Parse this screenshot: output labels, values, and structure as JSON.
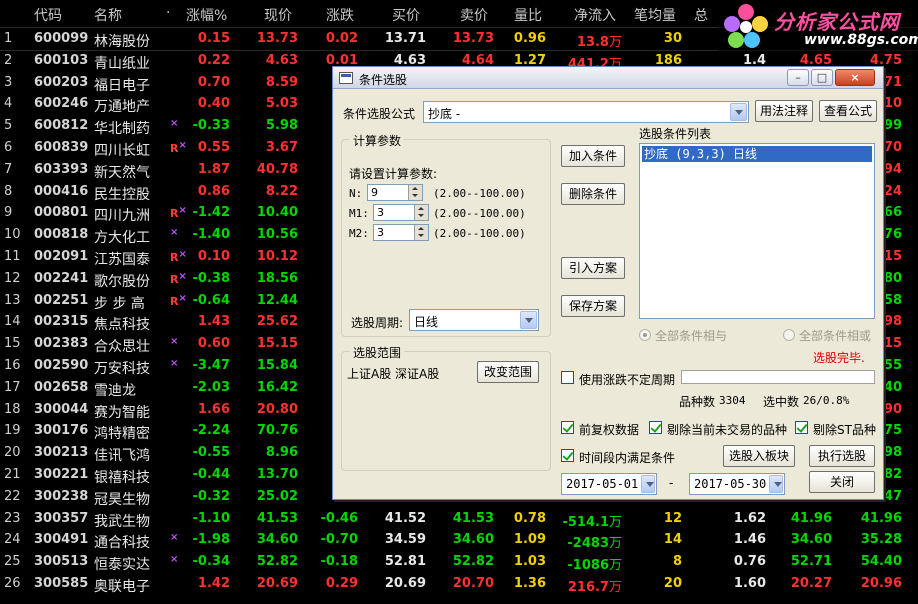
{
  "columns": [
    "代码",
    "名称",
    "·",
    "涨幅%",
    "现价",
    "涨跌",
    "买价",
    "卖价",
    "量比",
    "净流入",
    "笔均量",
    "总"
  ],
  "rows": [
    {
      "idx": "1",
      "code": "600099",
      "name": "林海股份",
      "flag": "",
      "chg": "0.15",
      "price": "13.73",
      "diff": "0.02",
      "bid": "13.71",
      "ask": "13.73",
      "ratio": "0.96",
      "flow": "13.8",
      "flow_unit": "万",
      "avg": "30",
      "tot": "",
      "h": "",
      "l": "",
      "up": true
    },
    {
      "idx": "2",
      "code": "600103",
      "name": "青山纸业",
      "flag": "",
      "chg": "0.22",
      "price": "4.63",
      "diff": "0.01",
      "bid": "4.63",
      "ask": "4.64",
      "ratio": "1.27",
      "flow": "441.2",
      "flow_unit": "万",
      "avg": "186",
      "tot": "1.4",
      "h": "4.65",
      "l": "4.75",
      "up": true
    },
    {
      "idx": "3",
      "code": "600203",
      "name": "福日电子",
      "flag": "",
      "chg": "0.70",
      "price": "8.59",
      "up": true,
      "h": "",
      "l": "",
      "l_tail": "71"
    },
    {
      "idx": "4",
      "code": "600246",
      "name": "万通地产",
      "flag": "",
      "chg": "0.40",
      "price": "5.03",
      "up": true,
      "l_tail": "10"
    },
    {
      "idx": "5",
      "code": "600812",
      "name": "华北制药",
      "flag": "x",
      "chg": "-0.33",
      "price": "5.98",
      "up": false,
      "l_tail": "99"
    },
    {
      "idx": "6",
      "code": "600839",
      "name": "四川长虹",
      "flag": "Rx",
      "chg": "0.55",
      "price": "3.67",
      "up": true,
      "l_tail": "70"
    },
    {
      "idx": "7",
      "code": "603393",
      "name": "新天然气",
      "flag": "",
      "chg": "1.87",
      "price": "40.78",
      "up": true,
      "l_tail": "94"
    },
    {
      "idx": "8",
      "code": "000416",
      "name": "民生控股",
      "flag": "",
      "chg": "0.86",
      "price": "8.22",
      "up": true,
      "l_tail": "24"
    },
    {
      "idx": "9",
      "code": "000801",
      "name": "四川九洲",
      "flag": "Rx",
      "chg": "-1.42",
      "price": "10.40",
      "up": false,
      "l_tail": "66"
    },
    {
      "idx": "10",
      "code": "000818",
      "name": "方大化工",
      "flag": "x",
      "chg": "-1.40",
      "price": "10.56",
      "up": false,
      "l_tail": "76"
    },
    {
      "idx": "11",
      "code": "002091",
      "name": "江苏国泰",
      "flag": "Rx",
      "chg": "0.10",
      "price": "10.12",
      "up": true,
      "l_tail": "15"
    },
    {
      "idx": "12",
      "code": "002241",
      "name": "歌尔股份",
      "flag": "Rx",
      "chg": "-0.38",
      "price": "18.56",
      "up": false,
      "l_tail": "80"
    },
    {
      "idx": "13",
      "code": "002251",
      "name": "步 步 高",
      "flag": "Rx",
      "chg": "-0.64",
      "price": "12.44",
      "up": false,
      "l_tail": "58"
    },
    {
      "idx": "14",
      "code": "002315",
      "name": "焦点科技",
      "flag": "",
      "chg": "1.43",
      "price": "25.62",
      "up": true,
      "l_tail": "98"
    },
    {
      "idx": "15",
      "code": "002383",
      "name": "合众思壮",
      "flag": "x",
      "chg": "0.60",
      "price": "15.15",
      "up": true,
      "l_tail": "15"
    },
    {
      "idx": "16",
      "code": "002590",
      "name": "万安科技",
      "flag": "x",
      "chg": "-3.47",
      "price": "15.84",
      "up": false,
      "l_tail": "55"
    },
    {
      "idx": "17",
      "code": "002658",
      "name": "雪迪龙",
      "flag": "",
      "chg": "-2.03",
      "price": "16.42",
      "up": false,
      "l_tail": "40"
    },
    {
      "idx": "18",
      "code": "300044",
      "name": "赛为智能",
      "flag": "",
      "chg": "1.66",
      "price": "20.80",
      "up": true,
      "l_tail": "90"
    },
    {
      "idx": "19",
      "code": "300176",
      "name": "鸿特精密",
      "flag": "",
      "chg": "-2.24",
      "price": "70.76",
      "up": false,
      "l_tail": "75"
    },
    {
      "idx": "20",
      "code": "300213",
      "name": "佳讯飞鸿",
      "flag": "",
      "chg": "-0.55",
      "price": "8.96",
      "up": false,
      "l_tail": "98"
    },
    {
      "idx": "21",
      "code": "300221",
      "name": "银禧科技",
      "flag": "",
      "chg": "-0.44",
      "price": "13.70",
      "up": false,
      "l_tail": "82"
    },
    {
      "idx": "22",
      "code": "300238",
      "name": "冠昊生物",
      "flag": "",
      "chg": "-0.32",
      "price": "25.02",
      "up": false,
      "l_tail": "47"
    },
    {
      "idx": "23",
      "code": "300357",
      "name": "我武生物",
      "flag": "",
      "chg": "-1.10",
      "price": "41.53",
      "diff": "-0.46",
      "bid": "41.52",
      "ask": "41.53",
      "ratio": "0.78",
      "flow": "-514.1",
      "flow_unit": "万",
      "avg": "12",
      "tot": "1.62",
      "h": "41.96",
      "l": "41.96",
      "up": false
    },
    {
      "idx": "24",
      "code": "300491",
      "name": "通合科技",
      "flag": "x",
      "chg": "-1.98",
      "price": "34.60",
      "diff": "-0.70",
      "bid": "34.59",
      "ask": "34.60",
      "ratio": "1.09",
      "flow": "-2483",
      "flow_unit": "万",
      "avg": "14",
      "tot": "1.46",
      "h": "34.60",
      "l": "35.28",
      "up": false
    },
    {
      "idx": "25",
      "code": "300513",
      "name": "恒泰实达",
      "flag": "x",
      "chg": "-0.34",
      "price": "52.82",
      "diff": "-0.18",
      "bid": "52.81",
      "ask": "52.82",
      "ratio": "1.03",
      "flow": "-1086",
      "flow_unit": "万",
      "avg": "8",
      "tot": "0.76",
      "h": "52.71",
      "l": "54.40",
      "up": false
    },
    {
      "idx": "26",
      "code": "300585",
      "name": "奥联电子",
      "flag": "",
      "chg": "1.42",
      "price": "20.69",
      "diff": "0.29",
      "bid": "20.69",
      "ask": "20.70",
      "ratio": "1.36",
      "flow": "216.7",
      "flow_unit": "万",
      "avg": "20",
      "tot": "1.60",
      "h": "20.27",
      "l": "20.96",
      "up": true
    }
  ],
  "logo": {
    "title": "分析家公式网",
    "url": "www.88gs.com"
  },
  "dialog": {
    "title": "条件选股",
    "formula_label": "条件选股公式",
    "formula_value": "抄底          -",
    "usage_btn": "用法注释",
    "view_btn": "查看公式",
    "params_group": "计算参数",
    "params_hint": "请设置计算参数:",
    "params": [
      {
        "name": "N:",
        "value": "9",
        "range": "(2.00--100.00)"
      },
      {
        "name": "M1:",
        "value": "3",
        "range": "(2.00--100.00)"
      },
      {
        "name": "M2:",
        "value": "3",
        "range": "(2.00--100.00)"
      }
    ],
    "period_label": "选股周期:",
    "period_value": "日线",
    "range_group": "选股范围",
    "range_value": "上证A股 深证A股",
    "change_range_btn": "改变范围",
    "add_cond_btn": "加入条件",
    "del_cond_btn": "删除条件",
    "import_btn": "引入方案",
    "save_btn": "保存方案",
    "cond_list_label": "选股条件列表",
    "cond_items": [
      "抄底 (9,3,3) 日线"
    ],
    "radio_and": "全部条件相与",
    "radio_or": "全部条件相或",
    "status": "选股完毕.",
    "use_uncertain": "使用涨跌不定周期",
    "count_label": "品种数",
    "count_value": "3304",
    "selected_label": "选中数",
    "selected_value": "26/0.8%",
    "chk_fq": "前复权数据",
    "chk_notrade": "剔除当前未交易的品种",
    "chk_st": "剔除ST品种",
    "chk_period": "时间段内满足条件",
    "to_board_btn": "选股入板块",
    "run_btn": "执行选股",
    "date_from": "2017-05-01",
    "date_sep": "-",
    "date_to": "2017-05-30",
    "close_btn": "关闭"
  },
  "colors": {
    "up": "#ff3030",
    "down": "#00d600",
    "highlight": "#316ac5"
  }
}
